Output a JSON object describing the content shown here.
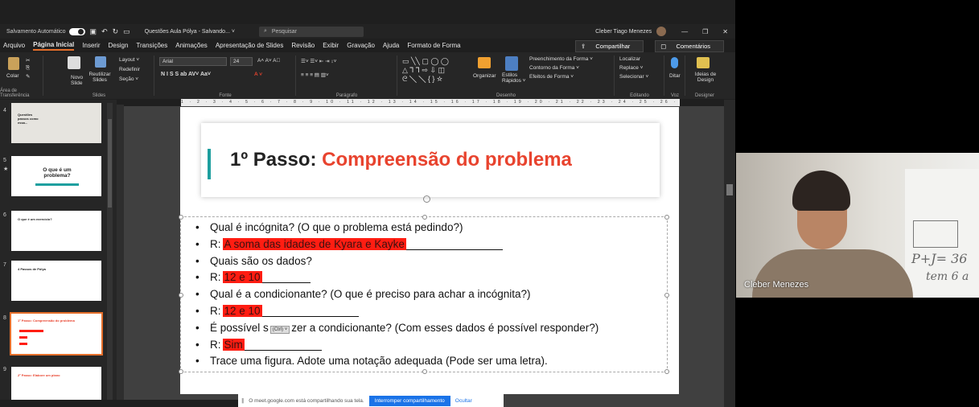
{
  "titlebar": {
    "autosave": "Salvamento Automático",
    "document": "Questões Aula Pólya - Salvando... ˅",
    "search_placeholder": "Pesquisar",
    "user": "Cleber Tiago Menezes",
    "minimize": "—",
    "maximize": "❐",
    "close": "✕"
  },
  "menu": {
    "items": [
      "Arquivo",
      "Página Inicial",
      "Inserir",
      "Design",
      "Transições",
      "Animações",
      "Apresentação de Slides",
      "Revisão",
      "Exibir",
      "Gravação",
      "Ajuda",
      "Formato de Forma"
    ],
    "share": "Compartilhar",
    "comments": "Comentários"
  },
  "ribbon": {
    "colar": "Colar",
    "novo_slide": "Novo Slide",
    "reutilizar": "Reutilizar Slides",
    "layout": "Layout ˅",
    "redefinir": "Redefinir",
    "secao": "Seção ˅",
    "font_name": "Arial",
    "font_size": "24",
    "organizar": "Organizar",
    "estilos": "Estilos Rápidos ˅",
    "preenchimento": "Preenchimento da Forma ˅",
    "contorno": "Contorno da Forma ˅",
    "efeitos": "Efeitos de Forma ˅",
    "localizar": "Localizar",
    "replace": "Replace ˅",
    "selecionar": "Selecionar ˅",
    "ditar": "Ditar",
    "ideias": "Ideias de Design",
    "groups": {
      "area": "Área de Transferência",
      "slides": "Slides",
      "fonte": "Fonte",
      "paragrafo": "Parágrafo",
      "desenho": "Desenho",
      "editando": "Editando",
      "voz": "Voz",
      "designer": "Designer"
    }
  },
  "ruler_text": "1 · 2 · 3 · 4 · 5 · 6 · 7 · 8 · 9 · 10 · 11 · 12 · 13 · 14 · 15 · 16 · 17 · 18 · 19 · 20 · 21 · 22 · 23 · 24 · 25 · 26 · 27 · 28 · 29 · 30 · 31 · 32 · 33",
  "thumbnails": [
    {
      "num": "4",
      "text": "Questões passos como essa..."
    },
    {
      "num": "5",
      "text": "O que é um problema?"
    },
    {
      "num": "6",
      "text": "O que é um exercício?"
    },
    {
      "num": "7",
      "text": "4 Passos de Pólya"
    },
    {
      "num": "8",
      "text": "1º Passo: Compreensão do problema"
    },
    {
      "num": "9",
      "text": "2º Passo: Elabore um plano"
    }
  ],
  "slide": {
    "title_black": "1º Passo: ",
    "title_red": "Compreensão do problema",
    "bullets": [
      {
        "text": "Qual é incógnita? (O que o problema está pedindo?)"
      },
      {
        "prefix": "R: ",
        "answer": "A soma das idades de Kyara e Kayke"
      },
      {
        "text": "Quais são os dados?"
      },
      {
        "prefix": "R: ",
        "answer": "12 e 10"
      },
      {
        "text": "Qual é a condicionante? (O que é preciso para achar a incógnita?)"
      },
      {
        "prefix": "R: ",
        "answer": "12 e 10"
      },
      {
        "text_a": "É possível s",
        "paste": "(Ctrl) ˅",
        "text_b": "zer a condicionante? (Com esses dados é possível responder?)"
      },
      {
        "prefix": "R: ",
        "answer": "Sim"
      },
      {
        "text": "Trace uma figura. Adote uma notação adequada (Pode ser uma letra)."
      }
    ]
  },
  "notice": {
    "text": "O meet.google.com está compartilhando sua tela.",
    "stop": "Interromper compartilhamento",
    "hide": "Ocultar"
  },
  "video": {
    "name": "Cleber Menezes",
    "board_line1": "P+J= 36",
    "board_line2": "tem 6 a"
  }
}
